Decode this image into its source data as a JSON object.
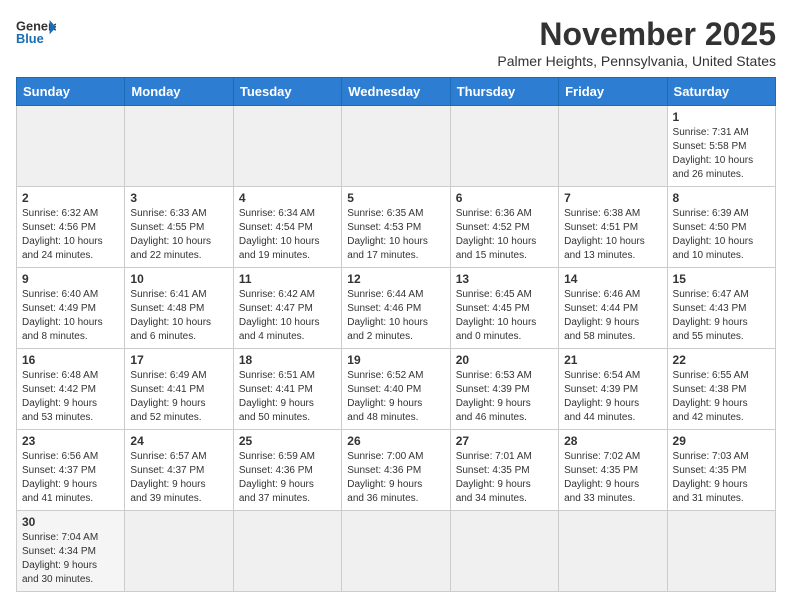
{
  "header": {
    "logo_general": "General",
    "logo_blue": "Blue",
    "month_title": "November 2025",
    "location": "Palmer Heights, Pennsylvania, United States"
  },
  "days_of_week": [
    "Sunday",
    "Monday",
    "Tuesday",
    "Wednesday",
    "Thursday",
    "Friday",
    "Saturday"
  ],
  "weeks": [
    [
      {
        "day": "",
        "info": "",
        "empty": true
      },
      {
        "day": "",
        "info": "",
        "empty": true
      },
      {
        "day": "",
        "info": "",
        "empty": true
      },
      {
        "day": "",
        "info": "",
        "empty": true
      },
      {
        "day": "",
        "info": "",
        "empty": true
      },
      {
        "day": "",
        "info": "",
        "empty": true
      },
      {
        "day": "1",
        "info": "Sunrise: 7:31 AM\nSunset: 5:58 PM\nDaylight: 10 hours\nand 26 minutes."
      }
    ],
    [
      {
        "day": "2",
        "info": "Sunrise: 6:32 AM\nSunset: 4:56 PM\nDaylight: 10 hours\nand 24 minutes."
      },
      {
        "day": "3",
        "info": "Sunrise: 6:33 AM\nSunset: 4:55 PM\nDaylight: 10 hours\nand 22 minutes."
      },
      {
        "day": "4",
        "info": "Sunrise: 6:34 AM\nSunset: 4:54 PM\nDaylight: 10 hours\nand 19 minutes."
      },
      {
        "day": "5",
        "info": "Sunrise: 6:35 AM\nSunset: 4:53 PM\nDaylight: 10 hours\nand 17 minutes."
      },
      {
        "day": "6",
        "info": "Sunrise: 6:36 AM\nSunset: 4:52 PM\nDaylight: 10 hours\nand 15 minutes."
      },
      {
        "day": "7",
        "info": "Sunrise: 6:38 AM\nSunset: 4:51 PM\nDaylight: 10 hours\nand 13 minutes."
      },
      {
        "day": "8",
        "info": "Sunrise: 6:39 AM\nSunset: 4:50 PM\nDaylight: 10 hours\nand 10 minutes."
      }
    ],
    [
      {
        "day": "9",
        "info": "Sunrise: 6:40 AM\nSunset: 4:49 PM\nDaylight: 10 hours\nand 8 minutes."
      },
      {
        "day": "10",
        "info": "Sunrise: 6:41 AM\nSunset: 4:48 PM\nDaylight: 10 hours\nand 6 minutes."
      },
      {
        "day": "11",
        "info": "Sunrise: 6:42 AM\nSunset: 4:47 PM\nDaylight: 10 hours\nand 4 minutes."
      },
      {
        "day": "12",
        "info": "Sunrise: 6:44 AM\nSunset: 4:46 PM\nDaylight: 10 hours\nand 2 minutes."
      },
      {
        "day": "13",
        "info": "Sunrise: 6:45 AM\nSunset: 4:45 PM\nDaylight: 10 hours\nand 0 minutes."
      },
      {
        "day": "14",
        "info": "Sunrise: 6:46 AM\nSunset: 4:44 PM\nDaylight: 9 hours\nand 58 minutes."
      },
      {
        "day": "15",
        "info": "Sunrise: 6:47 AM\nSunset: 4:43 PM\nDaylight: 9 hours\nand 55 minutes."
      }
    ],
    [
      {
        "day": "16",
        "info": "Sunrise: 6:48 AM\nSunset: 4:42 PM\nDaylight: 9 hours\nand 53 minutes."
      },
      {
        "day": "17",
        "info": "Sunrise: 6:49 AM\nSunset: 4:41 PM\nDaylight: 9 hours\nand 52 minutes."
      },
      {
        "day": "18",
        "info": "Sunrise: 6:51 AM\nSunset: 4:41 PM\nDaylight: 9 hours\nand 50 minutes."
      },
      {
        "day": "19",
        "info": "Sunrise: 6:52 AM\nSunset: 4:40 PM\nDaylight: 9 hours\nand 48 minutes."
      },
      {
        "day": "20",
        "info": "Sunrise: 6:53 AM\nSunset: 4:39 PM\nDaylight: 9 hours\nand 46 minutes."
      },
      {
        "day": "21",
        "info": "Sunrise: 6:54 AM\nSunset: 4:39 PM\nDaylight: 9 hours\nand 44 minutes."
      },
      {
        "day": "22",
        "info": "Sunrise: 6:55 AM\nSunset: 4:38 PM\nDaylight: 9 hours\nand 42 minutes."
      }
    ],
    [
      {
        "day": "23",
        "info": "Sunrise: 6:56 AM\nSunset: 4:37 PM\nDaylight: 9 hours\nand 41 minutes."
      },
      {
        "day": "24",
        "info": "Sunrise: 6:57 AM\nSunset: 4:37 PM\nDaylight: 9 hours\nand 39 minutes."
      },
      {
        "day": "25",
        "info": "Sunrise: 6:59 AM\nSunset: 4:36 PM\nDaylight: 9 hours\nand 37 minutes."
      },
      {
        "day": "26",
        "info": "Sunrise: 7:00 AM\nSunset: 4:36 PM\nDaylight: 9 hours\nand 36 minutes."
      },
      {
        "day": "27",
        "info": "Sunrise: 7:01 AM\nSunset: 4:35 PM\nDaylight: 9 hours\nand 34 minutes."
      },
      {
        "day": "28",
        "info": "Sunrise: 7:02 AM\nSunset: 4:35 PM\nDaylight: 9 hours\nand 33 minutes."
      },
      {
        "day": "29",
        "info": "Sunrise: 7:03 AM\nSunset: 4:35 PM\nDaylight: 9 hours\nand 31 minutes."
      }
    ],
    [
      {
        "day": "30",
        "info": "Sunrise: 7:04 AM\nSunset: 4:34 PM\nDaylight: 9 hours\nand 30 minutes."
      },
      {
        "day": "",
        "info": "",
        "empty": true
      },
      {
        "day": "",
        "info": "",
        "empty": true
      },
      {
        "day": "",
        "info": "",
        "empty": true
      },
      {
        "day": "",
        "info": "",
        "empty": true
      },
      {
        "day": "",
        "info": "",
        "empty": true
      },
      {
        "day": "",
        "info": "",
        "empty": true
      }
    ]
  ]
}
